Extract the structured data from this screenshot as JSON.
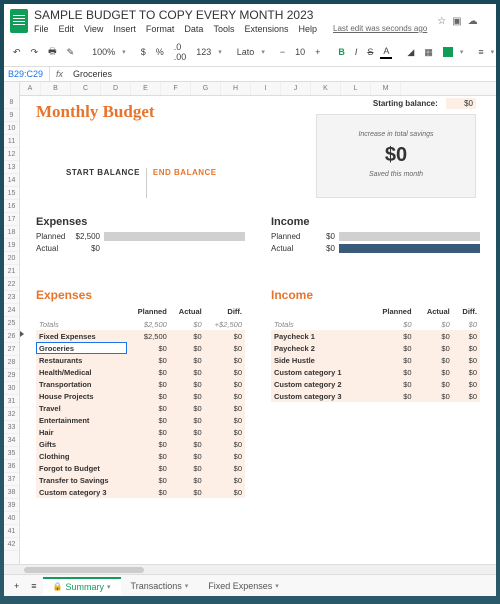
{
  "doc": {
    "title": "SAMPLE BUDGET TO COPY EVERY MONTH 2023",
    "last_edit": "Last edit was seconds ago"
  },
  "menu": [
    "File",
    "Edit",
    "View",
    "Insert",
    "Format",
    "Data",
    "Tools",
    "Extensions",
    "Help"
  ],
  "toolbar": {
    "zoom": "100%",
    "currency": "$",
    "percent": "%",
    "decimals": ".0 .00",
    "fmt": "123",
    "font": "Lato",
    "size": "10"
  },
  "formula": {
    "ref": "B29:C29",
    "value": "Groceries"
  },
  "cols": [
    "A",
    "B",
    "C",
    "D",
    "E",
    "F",
    "G",
    "H",
    "I",
    "J",
    "K",
    "L",
    "M"
  ],
  "rows_start": 8,
  "rows_end": 42,
  "budget": {
    "title": "Monthly Budget",
    "starting_label": "Starting balance:",
    "starting_value": "$0",
    "start_label": "START BALANCE",
    "end_label": "END BALANCE",
    "card_inc": "Increase in total savings",
    "card_big": "$0",
    "card_sub": "Saved this month"
  },
  "summary": {
    "exp": {
      "h": "Expenses",
      "planned_l": "Planned",
      "planned_v": "$2,500",
      "actual_l": "Actual",
      "actual_v": "$0"
    },
    "inc": {
      "h": "Income",
      "planned_l": "Planned",
      "planned_v": "$0",
      "actual_l": "Actual",
      "actual_v": "$0"
    }
  },
  "tables": {
    "exp_h": "Expenses",
    "inc_h": "Income",
    "cols": [
      "",
      "Planned",
      "Actual",
      "Diff."
    ],
    "totals_l": "Totals",
    "exp_totals": [
      "$2,500",
      "$0",
      "+$2,500"
    ],
    "inc_totals": [
      "$0",
      "$0",
      "$0"
    ],
    "exp_rows": [
      {
        "n": "Fixed Expenses",
        "p": "$2,500",
        "a": "$0",
        "d": "$0",
        "sel": false
      },
      {
        "n": "Groceries",
        "p": "$0",
        "a": "$0",
        "d": "$0",
        "sel": true
      },
      {
        "n": "Restaurants",
        "p": "$0",
        "a": "$0",
        "d": "$0"
      },
      {
        "n": "Health/Medical",
        "p": "$0",
        "a": "$0",
        "d": "$0"
      },
      {
        "n": "Transportation",
        "p": "$0",
        "a": "$0",
        "d": "$0"
      },
      {
        "n": "House Projects",
        "p": "$0",
        "a": "$0",
        "d": "$0"
      },
      {
        "n": "Travel",
        "p": "$0",
        "a": "$0",
        "d": "$0"
      },
      {
        "n": "Entertainment",
        "p": "$0",
        "a": "$0",
        "d": "$0"
      },
      {
        "n": "Hair",
        "p": "$0",
        "a": "$0",
        "d": "$0"
      },
      {
        "n": "Gifts",
        "p": "$0",
        "a": "$0",
        "d": "$0"
      },
      {
        "n": "Clothing",
        "p": "$0",
        "a": "$0",
        "d": "$0"
      },
      {
        "n": "Forgot to Budget",
        "p": "$0",
        "a": "$0",
        "d": "$0"
      },
      {
        "n": "Transfer to Savings",
        "p": "$0",
        "a": "$0",
        "d": "$0"
      },
      {
        "n": "Custom category 3",
        "p": "$0",
        "a": "$0",
        "d": "$0"
      }
    ],
    "inc_rows": [
      {
        "n": "Paycheck 1",
        "p": "$0",
        "a": "$0",
        "d": "$0"
      },
      {
        "n": "Paycheck 2",
        "p": "$0",
        "a": "$0",
        "d": "$0"
      },
      {
        "n": "Side Hustle",
        "p": "$0",
        "a": "$0",
        "d": "$0"
      },
      {
        "n": "Custom category 1",
        "p": "$0",
        "a": "$0",
        "d": "$0"
      },
      {
        "n": "Custom category 2",
        "p": "$0",
        "a": "$0",
        "d": "$0"
      },
      {
        "n": "Custom category 3",
        "p": "$0",
        "a": "$0",
        "d": "$0"
      }
    ]
  },
  "tabs": {
    "summary": "Summary",
    "transactions": "Transactions",
    "fixed": "Fixed Expenses"
  }
}
